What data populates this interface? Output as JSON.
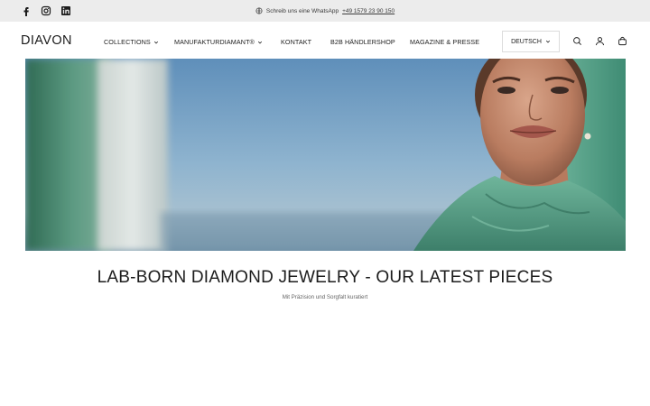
{
  "announcement": {
    "text": "Schreib uns eine WhatsApp",
    "phone": "+49 1579 23 90 150"
  },
  "social": [
    {
      "name": "facebook-icon"
    },
    {
      "name": "instagram-icon"
    },
    {
      "name": "linkedin-icon"
    }
  ],
  "header": {
    "logo": "DIAVON",
    "nav": [
      {
        "label": "COLLECTIONS",
        "has_dropdown": true
      },
      {
        "label": "MANUFAKTURDIAMANT®",
        "has_dropdown": true
      },
      {
        "label": "KONTAKT",
        "has_dropdown": false
      },
      {
        "label": "B2B HÄNDLERSHOP",
        "has_dropdown": false
      },
      {
        "label": "MAGAZINE & PRESSE",
        "has_dropdown": false
      }
    ],
    "language": "DEUTSCH",
    "icons": [
      "search-icon",
      "account-icon",
      "cart-icon"
    ]
  },
  "main": {
    "heading": "LAB-BORN DIAMOND JEWELRY - OUR LATEST PIECES",
    "subheading": "Mit Präzision und Sorgfalt kuratiert"
  },
  "colors": {
    "topbar_bg": "#ececec",
    "text": "#1c1c1c",
    "hero_sky": "#7aa6c9",
    "hero_green": "#4f9a7e"
  }
}
